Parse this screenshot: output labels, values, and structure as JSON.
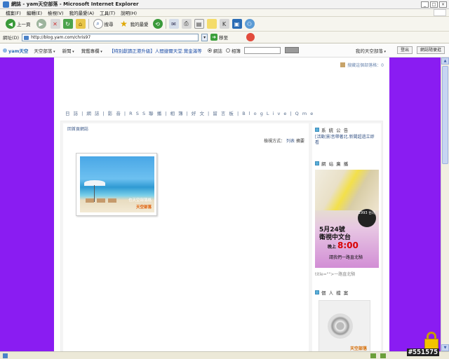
{
  "window": {
    "title": "網誌 - yam天空部落 - Microsoft Internet Explorer",
    "controls": [
      "_",
      "□",
      "×"
    ]
  },
  "menu": [
    "檔案(F)",
    "編輯(E)",
    "檢視(V)",
    "我的最愛(A)",
    "工具(T)",
    "說明(H)"
  ],
  "toolbar": {
    "back_label": "上一頁",
    "search_label": "搜尋",
    "favorites_label": "我的最愛"
  },
  "address": {
    "label": "網址(D)",
    "url": "http://blog.yam.com/chris97",
    "go_label": "移至"
  },
  "yambar": {
    "logo": "yam天空",
    "menus": [
      "天空部落",
      "新聞",
      "賞鑑專欄"
    ],
    "promo": "【特別獻讀正港升級】人間捷爾天堂.賞金滿等",
    "radio_blog": "網誌",
    "radio_album": "相簿",
    "my_blog": "我的天空部落",
    "logout": "登出",
    "random": "網誌隨便逛"
  },
  "page": {
    "visit_count": "搜藏這個部落格：0",
    "navlinks": "日 誌 | 網 誌 | 影 音 | R S S 聯 播 | 相 簿 | 好 文 | 留 言 板 | B l o g L i v e | Q m e",
    "back_link": "回首頁網誌",
    "sort_label": "檢視方式：",
    "sort_list": "列表",
    "sort_summary": "摘要",
    "photo_caption": "也天空部落格",
    "photo_brand": "天空部落"
  },
  "sidebar": {
    "announce_title": "系 統 公 告",
    "announce_text": "[活動]影音帶著北.新聞超過立即看",
    "ad_title": "網 站 廣 播",
    "ad_badge": "1993 台北",
    "ad_date": "5月24號",
    "ad_channel": "衛視中文台",
    "ad_time_prefix": "晚上",
    "ad_time": "8:00",
    "ad_slogan": "請我們一路直北騎",
    "ad_caption": "title=\"\">一路直北騎",
    "profile_title": "個 人 檔 案",
    "profile_brand": "天空部落"
  },
  "overlay": {
    "watermark": "#551575"
  }
}
